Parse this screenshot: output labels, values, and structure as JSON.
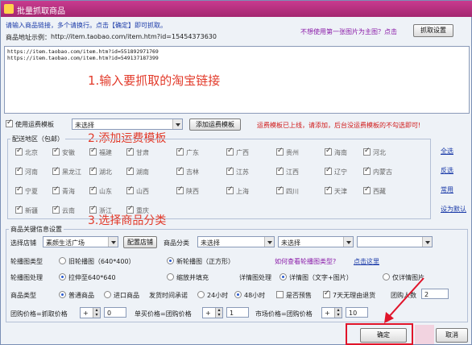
{
  "window": {
    "title": "批量抓取商品"
  },
  "top": {
    "instruction": "请输入商品链接，多个请换行。点击【确定】即可抓取。",
    "example_label": "商品地址示例：",
    "example_url": "http://item.taobao.com/item.htm?id=15454373630",
    "main_image_hint": "不想使用第一张图片为主图？点击",
    "grab_settings_button": "抓取设置"
  },
  "links_box": {
    "lines": [
      "https://item.taobao.com/item.htm?id=551892971769",
      "https://item.taobao.com/item.htm?id=549137187399"
    ]
  },
  "annotations": {
    "step1": "1.输入要抓取的淘宝链接",
    "step2": "2.添加运费模板",
    "step3": "3.选择商品分类"
  },
  "freight": {
    "use_template_label": "使用运费模板",
    "template_select": "未选择",
    "add_template_button": "添加运费模板",
    "warning": "运费模板已上线，请添加，后台没运费模板的不勾选即可!"
  },
  "delivery": {
    "legend": "配送地区（包邮）",
    "regions": [
      [
        "北京",
        "安徽",
        "福建",
        "甘肃",
        "广东",
        "广西",
        "贵州",
        "海南",
        "河北"
      ],
      [
        "河南",
        "黑龙江",
        "湖北",
        "湖南",
        "吉林",
        "江苏",
        "江西",
        "辽宁",
        "内蒙古"
      ],
      [
        "宁夏",
        "青海",
        "山东",
        "山西",
        "陕西",
        "上海",
        "四川",
        "天津",
        "西藏"
      ],
      [
        "新疆",
        "云南",
        "浙江",
        "重庆"
      ]
    ],
    "side_links": [
      "全选",
      "反选",
      "常用",
      "设为默认"
    ]
  },
  "product_info": {
    "legend": "商品关键信息设置",
    "store_label": "选择店铺",
    "store_value": "素颜生活广场",
    "config_store_button": "配置店铺",
    "category_label": "商品分类",
    "category_1": "未选择",
    "category_2": "未选择",
    "category_3": "",
    "carousel_type_label": "轮播图类型",
    "carousel_old": "旧轮播图（640*400）",
    "carousel_new": "新轮播图（正方形）",
    "carousel_help": "如何查看轮播图类型?",
    "click_here": "点击这里",
    "carousel_process_label": "轮播图处理",
    "stretch_option": "拉伸至640*640",
    "shrink_option": "缩放并填充",
    "detail_process_label": "详情图处理",
    "detail_text_image": "详情图（文字+图片）",
    "detail_image_only": "仅详情图片",
    "product_type_label": "商品类型",
    "normal_product": "普通商品",
    "import_product": "进口商品",
    "ship_time_label": "发货时间承诺",
    "h24": "24小时",
    "h48": "48小时",
    "presale_label": "是否预售",
    "seven_day_label": "7天无理由退货",
    "group_size_label": "团购人数",
    "group_size_value": "2",
    "group_price_label": "团购价格=抓取价格",
    "group_price_op": "+",
    "group_price_value": "0",
    "single_price_label": "单买价格=团购价格",
    "single_price_op": "+",
    "single_price_value": "1",
    "market_price_label": "市场价格=团购价格",
    "market_price_op": "+",
    "market_price_value": "10"
  },
  "footer": {
    "confirm_button": "确定",
    "cancel_button": "取消"
  },
  "colors": {
    "title_bar": "#a32670",
    "annotation": "#e23a2a",
    "highlight": "#e0142a"
  }
}
